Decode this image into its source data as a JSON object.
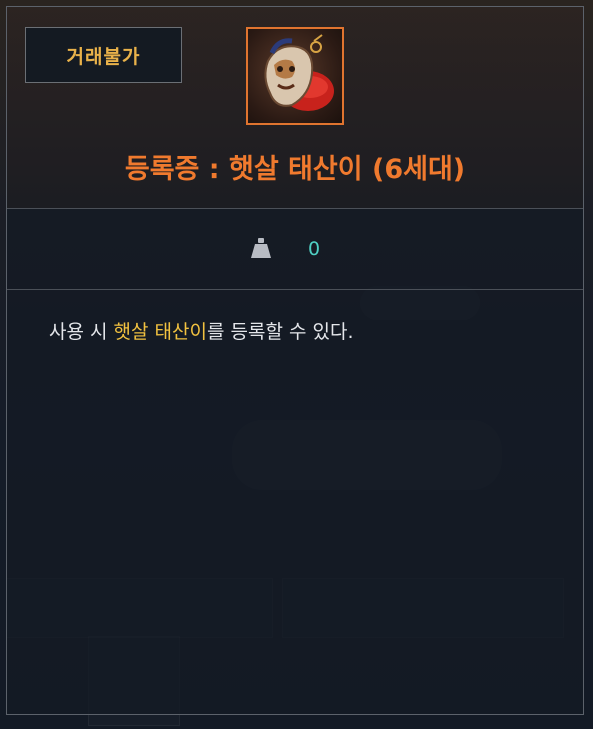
{
  "badge": {
    "label": "거래불가"
  },
  "item": {
    "title": "등록증 : 햇살 태산이 (6세대)",
    "icon_name": "lion-mascot-registration-icon",
    "frame_color": "#e0742f"
  },
  "stats": {
    "weight_icon": "weight-icon",
    "weight_value": "0"
  },
  "description": {
    "prefix": "사용 시 ",
    "highlight": "햇살 태산이",
    "suffix": "를 등록할 수 있다."
  },
  "colors": {
    "title": "#f07a2e",
    "badge_text": "#e9b24a",
    "highlight": "#f2c240",
    "weight_value": "#4fd0c4"
  }
}
